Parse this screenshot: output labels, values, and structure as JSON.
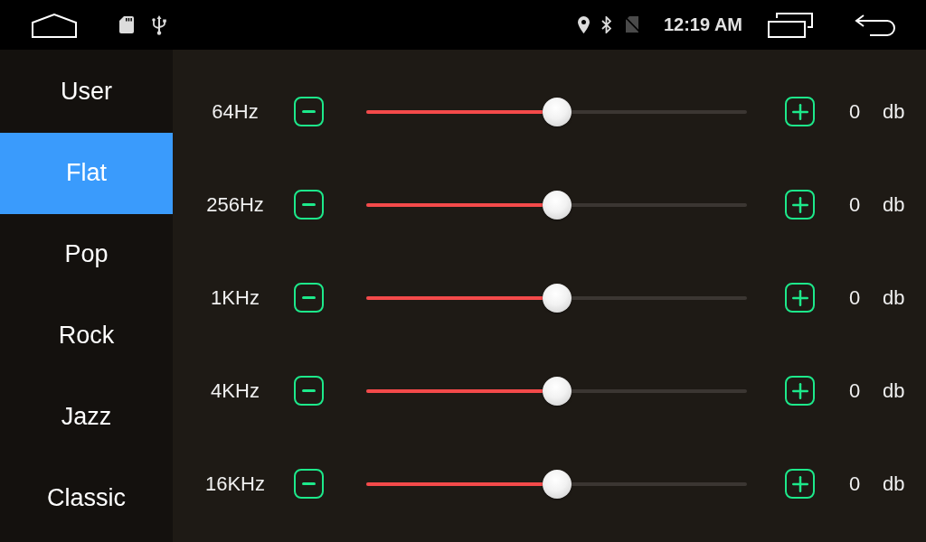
{
  "status_bar": {
    "time": "12:19 AM"
  },
  "presets": [
    {
      "label": "User",
      "selected": false
    },
    {
      "label": "Flat",
      "selected": true
    },
    {
      "label": "Pop",
      "selected": false
    },
    {
      "label": "Rock",
      "selected": false
    },
    {
      "label": "Jazz",
      "selected": false
    },
    {
      "label": "Classic",
      "selected": false
    }
  ],
  "bands": [
    {
      "label": "64Hz",
      "level": 0.5,
      "value": "0",
      "unit": "db"
    },
    {
      "label": "256Hz",
      "level": 0.5,
      "value": "0",
      "unit": "db"
    },
    {
      "label": "1KHz",
      "level": 0.5,
      "value": "0",
      "unit": "db"
    },
    {
      "label": "4KHz",
      "level": 0.5,
      "value": "0",
      "unit": "db"
    },
    {
      "label": "16KHz",
      "level": 0.5,
      "value": "0",
      "unit": "db"
    }
  ]
}
